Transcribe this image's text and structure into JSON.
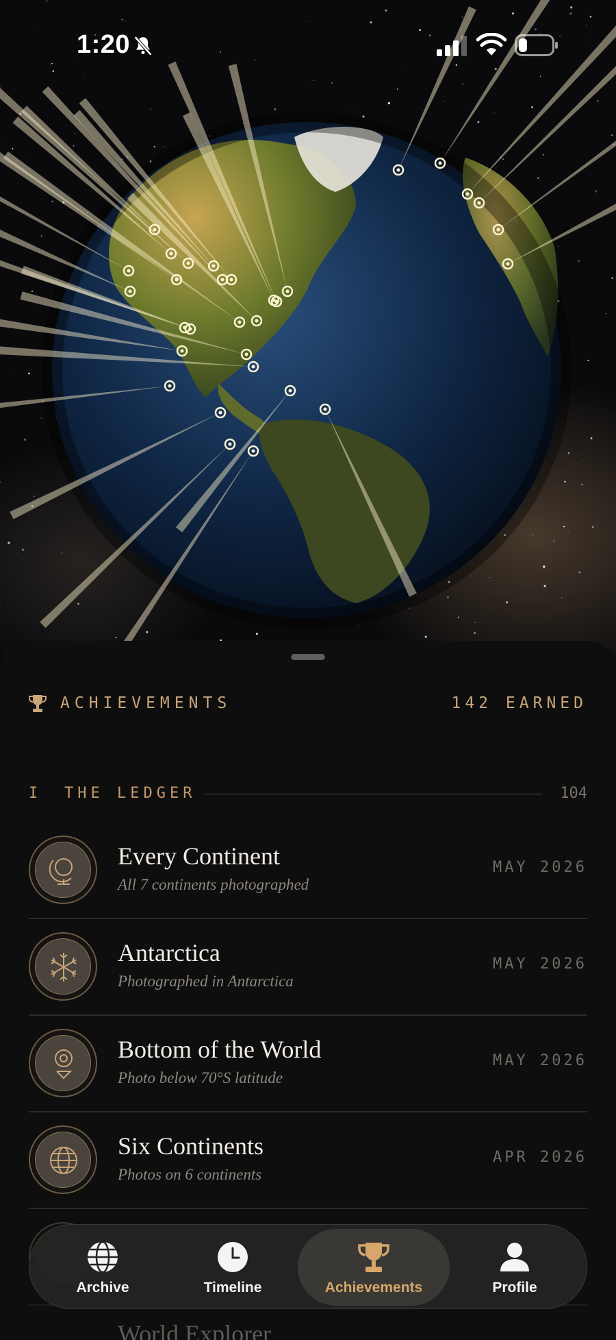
{
  "status_bar": {
    "time": "1:20",
    "icons": [
      "bell-slash-icon",
      "cellular-signal-icon",
      "wifi-icon",
      "battery-icon"
    ]
  },
  "globe": {
    "description_icon": "globe-with-photo-pins"
  },
  "achievements": {
    "title": "ACHIEVEMENTS",
    "earned": "142 EARNED",
    "accent_color": "#c9a57a"
  },
  "section": {
    "number": "I",
    "title": "THE LEDGER",
    "count": "104"
  },
  "items": [
    {
      "title": "Every Continent",
      "subtitle": "All 7 continents photographed",
      "date": "MAY 2026",
      "icon": "globe-stand-icon"
    },
    {
      "title": "Antarctica",
      "subtitle": "Photographed in Antarctica",
      "date": "MAY 2026",
      "icon": "snowflake-icon"
    },
    {
      "title": "Bottom of the World",
      "subtitle": "Photo below 70°S latitude",
      "date": "MAY 2026",
      "icon": "location-pin-icon"
    },
    {
      "title": "Six Continents",
      "subtitle": "Photos on 6 continents",
      "date": "APR 2026",
      "icon": "globe-grid-icon"
    }
  ],
  "peek_item": {
    "title": "World Explorer"
  },
  "tabbar": {
    "tabs": [
      {
        "label": "Archive",
        "icon": "globe-icon"
      },
      {
        "label": "Timeline",
        "icon": "clock-icon"
      },
      {
        "label": "Achievements",
        "icon": "trophy-icon",
        "active": true
      },
      {
        "label": "Profile",
        "icon": "person-icon"
      }
    ]
  }
}
